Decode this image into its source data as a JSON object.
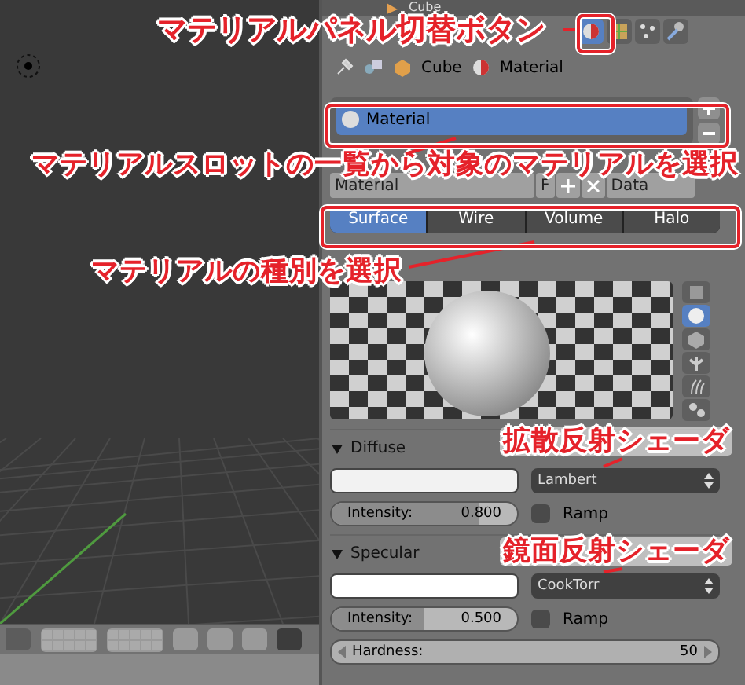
{
  "header": {
    "title": "Cube"
  },
  "property_tabs": [
    {
      "kind": "material",
      "selected": true
    },
    {
      "kind": "texture",
      "selected": false
    },
    {
      "kind": "particles",
      "selected": false
    },
    {
      "kind": "physics",
      "selected": false
    }
  ],
  "breadcrumb": [
    "Cube",
    "Material"
  ],
  "material_slots": [
    {
      "name": "Material",
      "selected": true
    }
  ],
  "datablock": {
    "name": "Material",
    "fake_user": "F",
    "link": "Data"
  },
  "material_types": [
    {
      "label": "Surface",
      "selected": true
    },
    {
      "label": "Wire",
      "selected": false
    },
    {
      "label": "Volume",
      "selected": false
    },
    {
      "label": "Halo",
      "selected": false
    }
  ],
  "preview_shapes": [
    {
      "kind": "plane",
      "selected": false
    },
    {
      "kind": "sphere",
      "selected": true
    },
    {
      "kind": "cube",
      "selected": false
    },
    {
      "kind": "tree",
      "selected": false
    },
    {
      "kind": "hair",
      "selected": false
    },
    {
      "kind": "spheres",
      "selected": false
    }
  ],
  "diffuse": {
    "title": "Diffuse",
    "shader": "Lambert",
    "intensity_label": "Intensity:",
    "intensity": "0.800",
    "level": 0.8,
    "ramp": {
      "label": "Ramp",
      "checked": false
    }
  },
  "specular": {
    "title": "Specular",
    "shader": "CookTorr",
    "intensity_label": "Intensity:",
    "intensity": "0.500",
    "level": 0.5,
    "ramp": {
      "label": "Ramp",
      "checked": false
    },
    "hardness_label": "Hardness:",
    "hardness": "50"
  },
  "annotations": [
    {
      "text": "マテリアルパネル切替ボタン",
      "framed": true
    },
    {
      "text": "マテリアルスロットの一覧から対象のマテリアルを選択",
      "framed": true
    },
    {
      "text": "マテリアルの種別を選択",
      "framed": true
    },
    {
      "text": "拡散反射シェーダ"
    },
    {
      "text": "鏡面反射シェーダ"
    }
  ]
}
